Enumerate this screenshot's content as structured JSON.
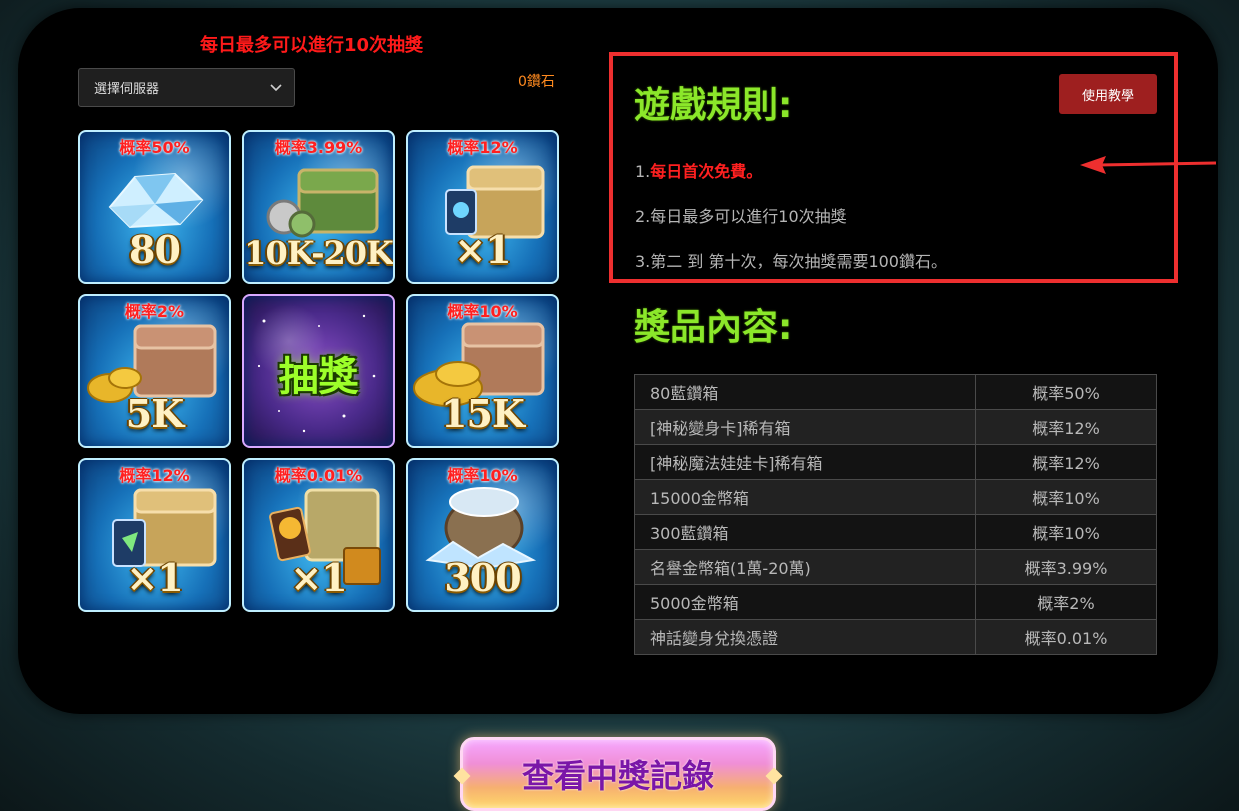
{
  "header": {
    "daily_limit_text": "每日最多可以進行10次抽獎",
    "diamond_count": "0鑽石"
  },
  "server_select": {
    "selected": "選擇伺服器"
  },
  "grid": {
    "tiles": [
      {
        "prob": "概率50%",
        "reward": "80"
      },
      {
        "prob": "概率3.99%",
        "reward": "10K-20K"
      },
      {
        "prob": "概率12%",
        "reward": "×1"
      },
      {
        "prob": "概率2%",
        "reward": "5K"
      },
      {
        "draw_label": "抽獎"
      },
      {
        "prob": "概率10%",
        "reward": "15K"
      },
      {
        "prob": "概率12%",
        "reward": "×1"
      },
      {
        "prob": "概率0.01%",
        "reward": "×1"
      },
      {
        "prob": "概率10%",
        "reward": "300"
      }
    ]
  },
  "rules": {
    "title": "遊戲規則:",
    "tutorial_button": "使用教學",
    "items": [
      {
        "prefix": "1.",
        "text": "每日首次免費。"
      },
      {
        "text": "2.每日最多可以進行10次抽獎"
      },
      {
        "text": "3.第二 到 第十次，每次抽獎需要100鑽石。"
      }
    ]
  },
  "prizes": {
    "title": "獎品內容:",
    "rows": [
      {
        "name": "80藍鑽箱",
        "rate": "概率50%"
      },
      {
        "name": "[神秘變身卡]稀有箱",
        "rate": "概率12%"
      },
      {
        "name": "[神秘魔法娃娃卡]稀有箱",
        "rate": "概率12%"
      },
      {
        "name": "15000金幣箱",
        "rate": "概率10%"
      },
      {
        "name": "300藍鑽箱",
        "rate": "概率10%"
      },
      {
        "name": "名譽金幣箱(1萬-20萬)",
        "rate": "概率3.99%"
      },
      {
        "name": "5000金幣箱",
        "rate": "概率2%"
      },
      {
        "name": "神話變身兌換憑證",
        "rate": "概率0.01%"
      }
    ]
  },
  "footer": {
    "record_button": "查看中獎記錄"
  },
  "colors": {
    "accent_red": "#ff2020",
    "title_green": "#8be72a",
    "diamond_orange": "#ff8a1f",
    "tutorial_red": "#9e1f1f"
  }
}
